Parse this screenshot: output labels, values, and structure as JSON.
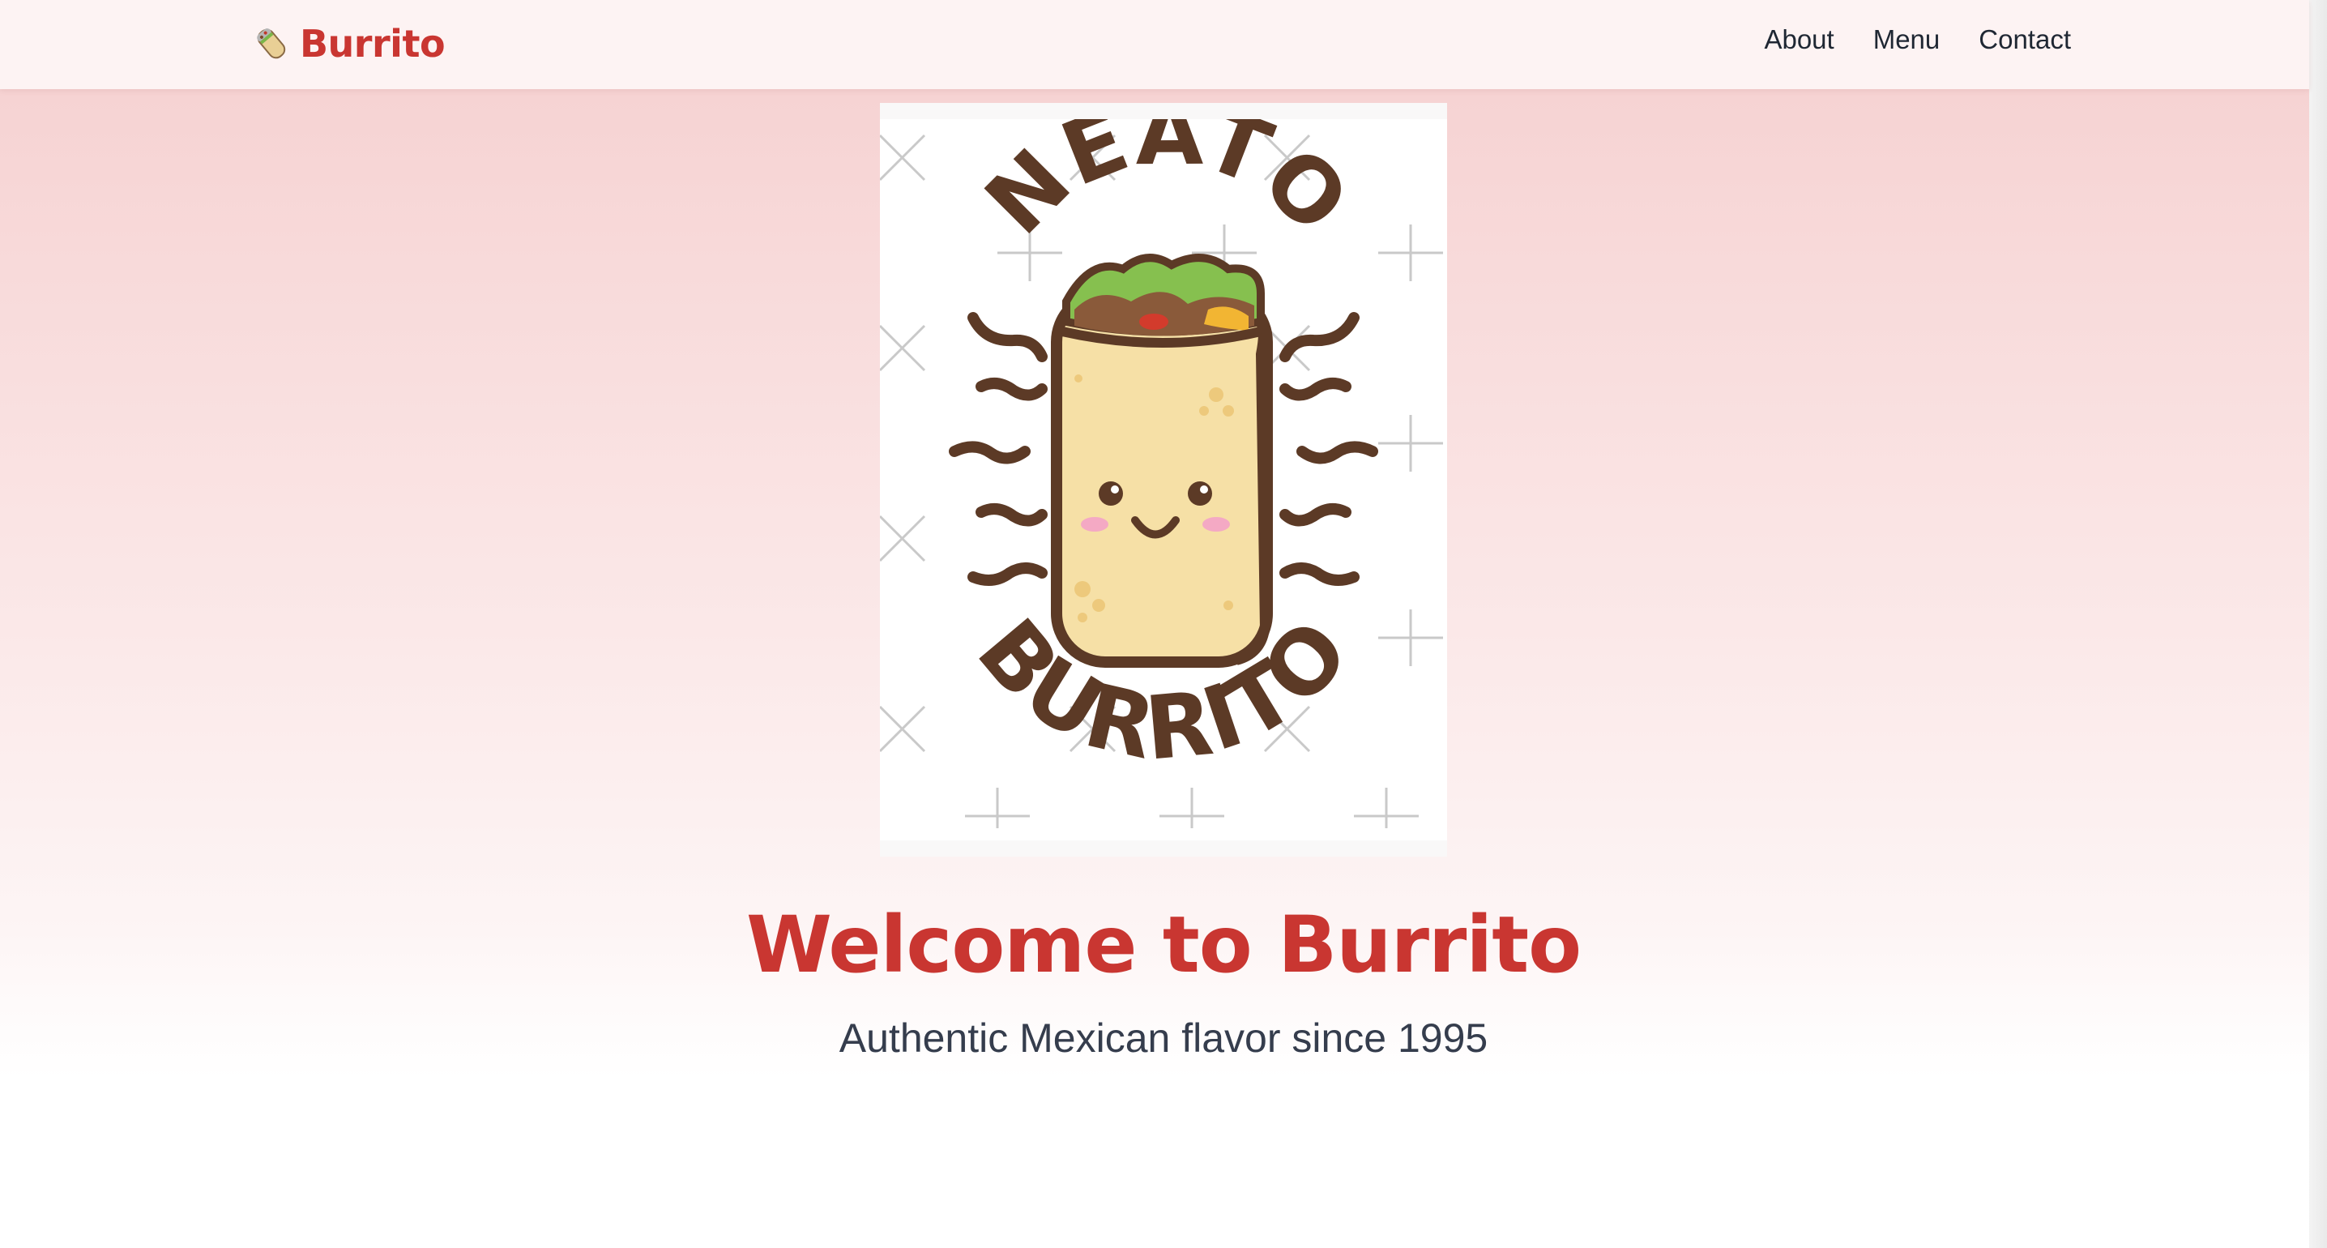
{
  "nav": {
    "brand_icon": "burrito-icon",
    "brand_name": "Burrito",
    "links": [
      "About",
      "Menu",
      "Contact"
    ]
  },
  "hero": {
    "image": {
      "top_text": "NEATO",
      "bottom_text": "BURRITO"
    },
    "title": "Welcome to Burrito",
    "subtitle": "Authentic Mexican flavor since 1995"
  },
  "colors": {
    "brand": "#c93631",
    "nav_text": "#1f2733",
    "subtitle_text": "#353d4d",
    "logo_brown": "#5c3a26",
    "tortilla": "#f6e0a6"
  }
}
